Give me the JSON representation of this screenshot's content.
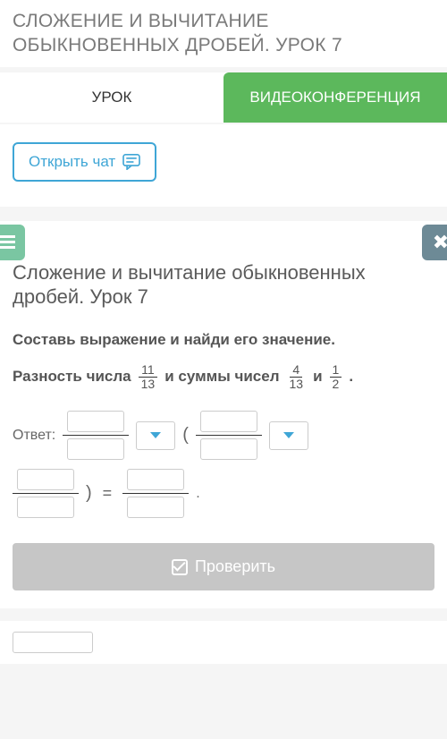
{
  "header": {
    "title": "СЛОЖЕНИЕ И ВЫЧИТАНИЕ ОБЫКНОВЕННЫХ ДРОБЕЙ. УРОК 7"
  },
  "tabs": {
    "lesson": "УРОК",
    "video": "ВИДЕОКОНФЕРЕНЦИЯ"
  },
  "chat": {
    "open_label": "Открыть чат"
  },
  "content": {
    "title": "Сложение и вычитание обыкновенных дробей. Урок 7",
    "task": "Составь выражение и найди его значение.",
    "problem": {
      "t1": "Разность числа",
      "f1_num": "11",
      "f1_den": "13",
      "t2": "и суммы чисел",
      "f2_num": "4",
      "f2_den": "13",
      "t3": "и",
      "f3_num": "1",
      "f3_den": "2",
      "t4": "."
    },
    "answer_label": "Ответ:",
    "paren_open": "(",
    "paren_close": ")",
    "equals": "=",
    "period": "."
  },
  "buttons": {
    "check": "Проверить"
  }
}
